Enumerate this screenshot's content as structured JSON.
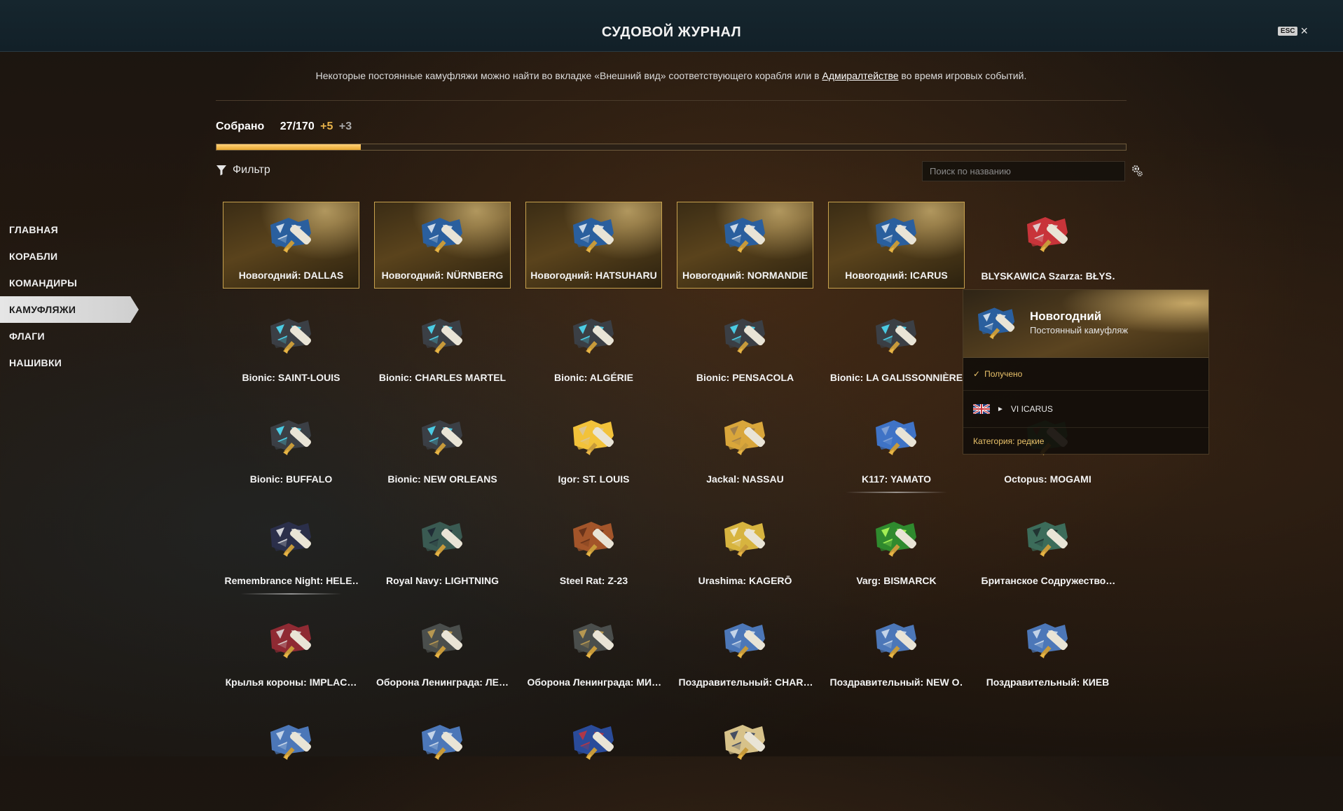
{
  "header": {
    "title": "СУДОВОЙ ЖУРНАЛ",
    "esc_label": "ESC"
  },
  "info": {
    "text_before": "Некоторые постоянные камуфляжи можно найти во вкладке «Внешний вид» соответствующего корабля или в ",
    "link": "Адмиралтействе",
    "text_after": " во время игровых событий."
  },
  "collected": {
    "label": "Собрано",
    "count": "27/170",
    "plus_new": "+5",
    "plus_other": "+3",
    "progress_fraction": 0.1588
  },
  "filter": {
    "label": "Фильтр"
  },
  "search": {
    "placeholder": "Поиск по названию"
  },
  "sidebar": {
    "items": [
      {
        "label": "ГЛАВНАЯ"
      },
      {
        "label": "КОРАБЛИ"
      },
      {
        "label": "КОМАНДИРЫ"
      },
      {
        "label": "КАМУФЛЯЖИ",
        "active": true
      },
      {
        "label": "ФЛАГИ"
      },
      {
        "label": "НАШИВКИ"
      }
    ]
  },
  "tiles": [
    {
      "name": "Новогодний: DALLAS",
      "style": "new",
      "colors": [
        "#2a5f9e",
        "#e8eef4"
      ]
    },
    {
      "name": "Новогодний: NÜRNBERG",
      "style": "new",
      "colors": [
        "#2a5f9e",
        "#e8eef4"
      ]
    },
    {
      "name": "Новогодний: HATSUHARU",
      "style": "new",
      "colors": [
        "#2a5f9e",
        "#e8eef4"
      ]
    },
    {
      "name": "Новогодний: NORMANDIE",
      "style": "new",
      "colors": [
        "#2a5f9e",
        "#e8eef4"
      ]
    },
    {
      "name": "Новогодний: ICARUS",
      "style": "new",
      "colors": [
        "#2a5f9e",
        "#e8eef4"
      ]
    },
    {
      "name": "BLYSKAWICA Szarza: BŁYS…",
      "style": "",
      "colors": [
        "#c8343a",
        "#e4e4e4"
      ]
    },
    {
      "name": "Bionic: SAINT-LOUIS",
      "style": "",
      "colors": [
        "#3b3f45",
        "#4fe4ff"
      ]
    },
    {
      "name": "Bionic: CHARLES MARTEL",
      "style": "",
      "colors": [
        "#3b3f45",
        "#4fe4ff"
      ]
    },
    {
      "name": "Bionic: ALGÉRIE",
      "style": "",
      "colors": [
        "#3b3f45",
        "#4fe4ff"
      ]
    },
    {
      "name": "Bionic: PENSACOLA",
      "style": "",
      "colors": [
        "#3b3f45",
        "#4fe4ff"
      ]
    },
    {
      "name": "Bionic: LA GALISSONNIÈRE",
      "style": "",
      "colors": [
        "#3b3f45",
        "#4fe4ff"
      ]
    },
    {
      "name": "",
      "style": "hidden",
      "colors": [
        "#3b3f45",
        "#4fe4ff"
      ]
    },
    {
      "name": "Bionic: BUFFALO",
      "style": "",
      "colors": [
        "#3b3f45",
        "#4fe4ff"
      ]
    },
    {
      "name": "Bionic: NEW ORLEANS",
      "style": "",
      "colors": [
        "#3b3f45",
        "#4fe4ff"
      ]
    },
    {
      "name": "Igor: ST. LOUIS",
      "style": "",
      "colors": [
        "#f2c23a",
        "#d8c6a0"
      ]
    },
    {
      "name": "Jackal: NASSAU",
      "style": "",
      "colors": [
        "#d9a63b",
        "#9a7a4e"
      ]
    },
    {
      "name": "K117: YAMATO",
      "style": "underline",
      "colors": [
        "#3f73c6",
        "#8aa8d8"
      ]
    },
    {
      "name": "Octopus: MOGAMI",
      "style": "",
      "colors": [
        "#2d6e3d",
        "#7a2d2d"
      ]
    },
    {
      "name": "Remembrance Night: HELE…",
      "style": "underline",
      "colors": [
        "#2b2f4a",
        "#f0f0f0"
      ]
    },
    {
      "name": "Royal Navy: LIGHTNING",
      "style": "",
      "colors": [
        "#3a5a52",
        "#1c2530"
      ]
    },
    {
      "name": "Steel Rat: Z-23",
      "style": "",
      "colors": [
        "#a3552a",
        "#5f2e17"
      ]
    },
    {
      "name": "Urashima: KAGERŌ",
      "style": "",
      "colors": [
        "#d7b43f",
        "#f5f0de"
      ]
    },
    {
      "name": "Varg: BISMARCK",
      "style": "",
      "colors": [
        "#2f8a2e",
        "#b6ff5a"
      ]
    },
    {
      "name": "Британское Содружество…",
      "style": "",
      "colors": [
        "#3c6c5a",
        "#1c2a2c"
      ]
    },
    {
      "name": "Крылья короны: IMPLAC…",
      "style": "",
      "colors": [
        "#8f2a33",
        "#e2dfdf"
      ]
    },
    {
      "name": "Оборона Ленинграда: ЛЕ…",
      "style": "",
      "colors": [
        "#4a4e4c",
        "#c9a552"
      ]
    },
    {
      "name": "Оборона Ленинграда: МИ…",
      "style": "",
      "colors": [
        "#4a4e4c",
        "#c9a552"
      ]
    },
    {
      "name": "Поздравительный: CHAR…",
      "style": "",
      "colors": [
        "#4c77b8",
        "#d8e3f0"
      ]
    },
    {
      "name": "Поздравительный: NEW O…",
      "style": "",
      "colors": [
        "#4c77b8",
        "#d8e3f0"
      ]
    },
    {
      "name": "Поздравительный: КИЕВ",
      "style": "",
      "colors": [
        "#4c77b8",
        "#d8e3f0"
      ]
    },
    {
      "name": "",
      "style": "partial",
      "colors": [
        "#4c77b8",
        "#d8e3f0"
      ]
    },
    {
      "name": "",
      "style": "partial",
      "colors": [
        "#4c77b8",
        "#d8e3f0"
      ]
    },
    {
      "name": "",
      "style": "partial",
      "colors": [
        "#2a4b9a",
        "#c8343a"
      ]
    },
    {
      "name": "",
      "style": "partial",
      "colors": [
        "#d7c28a",
        "#2c3a5a"
      ]
    }
  ],
  "tooltip": {
    "name": "Новогодний",
    "type": "Постоянный камуфляж",
    "status": "Получено",
    "ship": "VI ICARUS",
    "category": "Категория: редкие",
    "colors": [
      "#2a5f9e",
      "#e8eef4"
    ]
  }
}
